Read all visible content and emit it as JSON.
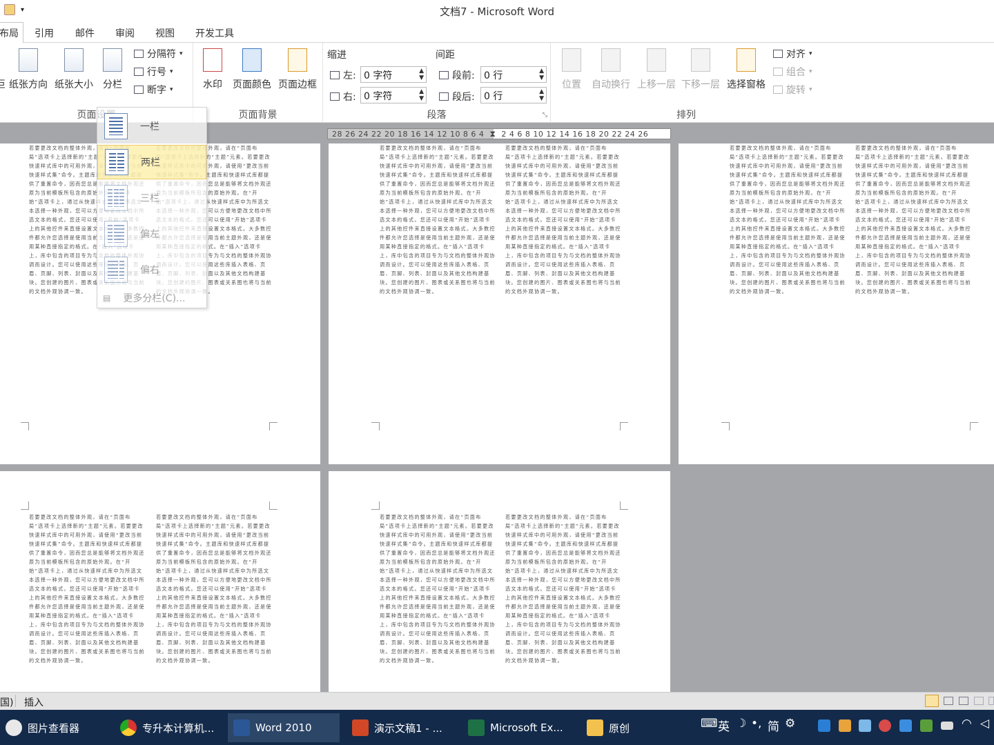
{
  "window": {
    "title": "文档7 - Microsoft Word"
  },
  "tabs": [
    "布局",
    "引用",
    "邮件",
    "审阅",
    "视图",
    "开发工具"
  ],
  "ribbon": {
    "page_setup": {
      "label": "页面设置",
      "cut_label": "巨",
      "orientation": "纸张方向",
      "size": "纸张大小",
      "columns": "分栏",
      "breaks": "分隔符",
      "line_numbers": "行号",
      "hyphenation": "断字"
    },
    "page_background": {
      "label": "页面背景",
      "watermark": "水印",
      "page_color": "页面颜色",
      "page_borders": "页面边框"
    },
    "paragraph": {
      "label": "段落",
      "indent_title": "缩进",
      "spacing_title": "间距",
      "left_label": "左:",
      "left_value": "0 字符",
      "right_label": "右:",
      "right_value": "0 字符",
      "before_label": "段前:",
      "before_value": "0 行",
      "after_label": "段后:",
      "after_value": "0 行"
    },
    "arrange": {
      "label": "排列",
      "position": "位置",
      "wrap_text": "自动换行",
      "bring_forward": "上移一层",
      "send_backward": "下移一层",
      "selection_pane": "选择窗格",
      "align": "对齐",
      "group": "组合",
      "rotate": "旋转"
    }
  },
  "ruler": {
    "left_numbers": "28 26 24 22 20 18 16 14 12 10 8 6 4",
    "right_numbers": "2 4 6 8 10 12 14 16 18 20 22 24 26"
  },
  "columns_menu": {
    "items": [
      "一栏",
      "两栏",
      "三栏",
      "偏左",
      "偏右"
    ],
    "more": "更多分栏(C)..."
  },
  "document": {
    "body_text": "若要更改文档的整体外观，请在“页面布局”选项卡上选择新的“主题”元素。若要更改快速样式库中的可用外观，请使用“更改当前快速样式集”命令。主题库和快速样式库都提供了重置命令，因而您总是能够将文档外观还原为当前模板所包含的原始外观。在“开始”选项卡上，通过从快速样式库中为所选文本选择一种外观，您可以方便地更改文档中所选文本的格式。您还可以使用“开始”选项卡上的其他控件来直接设置文本格式。大多数控件都允许您选择是使用当前主题外观，还是使用某种直接指定的格式。在“插入”选项卡上，库中包含的项目专为与文档的整体外观协调而设计。您可以使用这些库插入表格、页眉、页脚、列表、封面以及其他文档构建基块。您创建的图片、图表或关系图也将与当前的文档外观协调一致。"
  },
  "statusbar": {
    "left_fragment": "国)",
    "mode": "插入"
  },
  "taskbar": {
    "items": [
      "图片查看器",
      "专升本计算机...",
      "Word 2010",
      "演示文稿1 - ...",
      "Microsoft Ex...",
      "原创"
    ],
    "active": "Word 2010",
    "tray": [
      "英",
      "简"
    ]
  }
}
